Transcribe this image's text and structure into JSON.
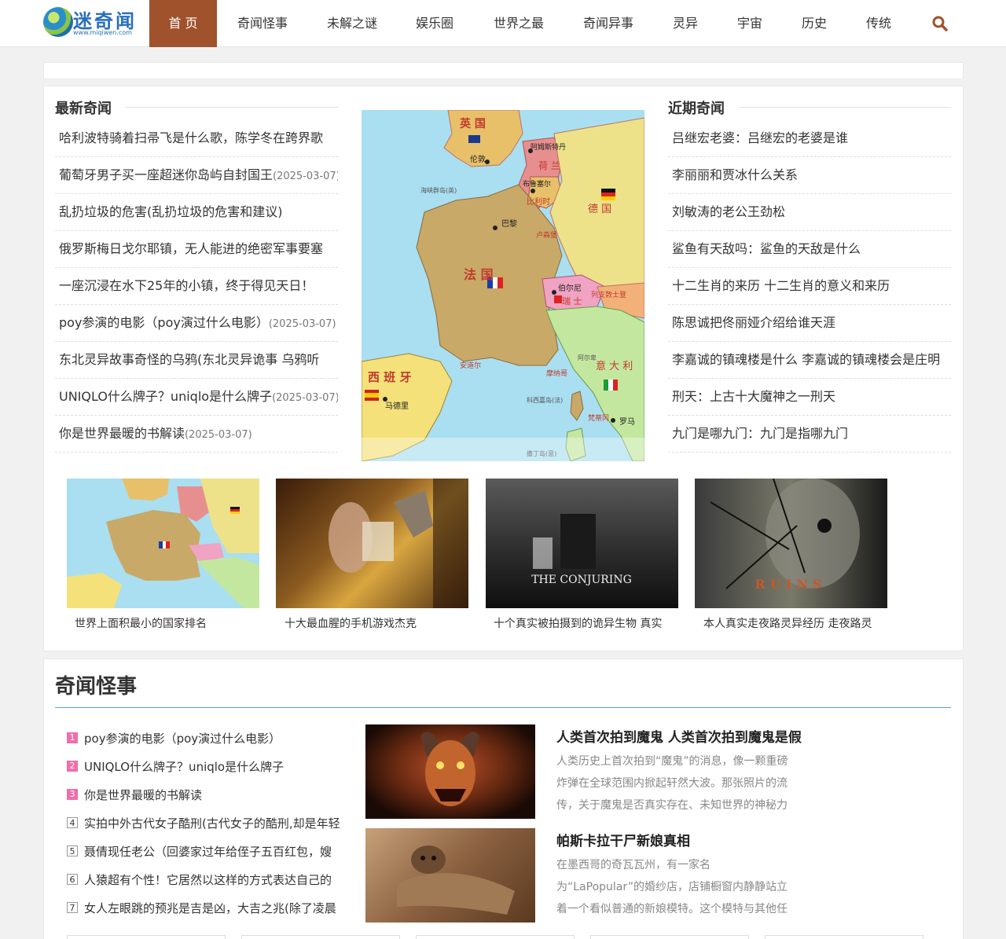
{
  "header": {
    "logo_text": "迷奇闻",
    "logo_url": "www.miqiwen.com",
    "nav": [
      "首 页",
      "奇闻怪事",
      "未解之谜",
      "娱乐圈",
      "世界之最",
      "奇闻异事",
      "灵异",
      "宇宙",
      "历史",
      "传统"
    ]
  },
  "latest": {
    "title": "最新奇闻",
    "items": [
      {
        "text": "哈利波特骑着扫帚飞是什么歌，陈学冬在跨界歌",
        "date": ""
      },
      {
        "text": "葡萄牙男子买一座超迷你岛屿自封国王",
        "date": "(2025-03-07)"
      },
      {
        "text": "乱扔垃圾的危害(乱扔垃圾的危害和建议)",
        "date": ""
      },
      {
        "text": "俄罗斯梅日戈尔耶镇，无人能进的绝密军事要塞",
        "date": ""
      },
      {
        "text": "一座沉浸在水下25年的小镇，终于得见天日！",
        "date": ""
      },
      {
        "text": "poy参演的电影（poy演过什么电影）",
        "date": "(2025-03-07)"
      },
      {
        "text": "东北灵异故事奇怪的乌鸦(东北灵异诡事 乌鸦听",
        "date": ""
      },
      {
        "text": "UNIQLO什么牌子？uniqlo是什么牌子",
        "date": "(2025-03-07)"
      },
      {
        "text": "你是世界最暖的书解读",
        "date": "(2025-03-07)"
      }
    ]
  },
  "recent": {
    "title": "近期奇闻",
    "items": [
      "吕继宏老婆：吕继宏的老婆是谁",
      "李丽丽和贾冰什么关系",
      "刘敏涛的老公王劲松",
      "鲨鱼有天敌吗：鲨鱼的天敌是什么",
      "十二生肖的来历 十二生肖的意义和来历",
      "陈思诚把佟丽娅介绍给谁天涯",
      "李嘉诚的镇魂楼是什么 李嘉诚的镇魂楼会是庄明",
      "刑天：上古十大魔神之一刑天",
      "九门是哪九门：九门是指哪九门"
    ]
  },
  "map_labels": {
    "uk": "英 国",
    "london": "伦敦",
    "amsterdam": "阿姆斯特丹",
    "nl": "荷 兰",
    "brussels": "布鲁塞尔",
    "be": "比利时",
    "de": "德 国",
    "paris": "巴黎",
    "lux": "卢森堡",
    "fr": "法 国",
    "bern": "伯尔尼",
    "ch": "瑞 士",
    "li": "列支敦士登",
    "andorra": "安道尔",
    "monaco": "摩纳哥",
    "es": "西 班 牙",
    "madrid": "马德里",
    "it": "意 大 利",
    "vatican": "梵蒂冈",
    "rome": "罗马",
    "corsica": "科西嘉岛(法)",
    "channel": "海峡群岛(英)",
    "alps": "阿尔卑",
    "sardinia": "撒丁岛(意)"
  },
  "thumbs": [
    {
      "caption": "世界上面积最小的国家排名"
    },
    {
      "caption": "十大最血腥的手机游戏杰克"
    },
    {
      "caption": "十个真实被拍摄到的诡异生物 真实"
    },
    {
      "caption": "本人真实走夜路灵异经历 走夜路灵"
    }
  ],
  "poster_text": {
    "conjuring": "THE CONJURING",
    "ruins": "RUINS"
  },
  "section": {
    "title": "奇闻怪事",
    "rank": [
      {
        "num": "1",
        "text": "poy参演的电影（poy演过什么电影）"
      },
      {
        "num": "2",
        "text": "UNIQLO什么牌子？uniqlo是什么牌子"
      },
      {
        "num": "3",
        "text": "你是世界最暖的书解读"
      },
      {
        "num": "4",
        "text": "实拍中外古代女子酷刑(古代女子的酷刑,却是年轻"
      },
      {
        "num": "5",
        "text": "聂倩现任老公（回婆家过年给侄子五百红包，嫂"
      },
      {
        "num": "6",
        "text": "人猿超有个性！它居然以这样的方式表达自己的"
      },
      {
        "num": "7",
        "text": "女人左眼跳的预兆是吉是凶，大吉之兆(除了凌晨"
      }
    ],
    "articles": [
      {
        "title": "人类首次拍到魔鬼 人类首次拍到魔鬼是假",
        "desc": "人类历史上首次拍到“魔鬼”的消息，像一颗重磅炸弹在全球范围内掀起轩然大波。那张照片的流传，关于魔鬼是否真实存在、未知世界的神秘力"
      },
      {
        "title": "帕斯卡拉干尸新娘真相",
        "desc": "在墨西哥的奇瓦瓦州，有一家名为“LaPopular”的婚纱店，店铺橱窗内静静站立着一个看似普通的新娘模特。这个模特与其他任"
      }
    ]
  }
}
